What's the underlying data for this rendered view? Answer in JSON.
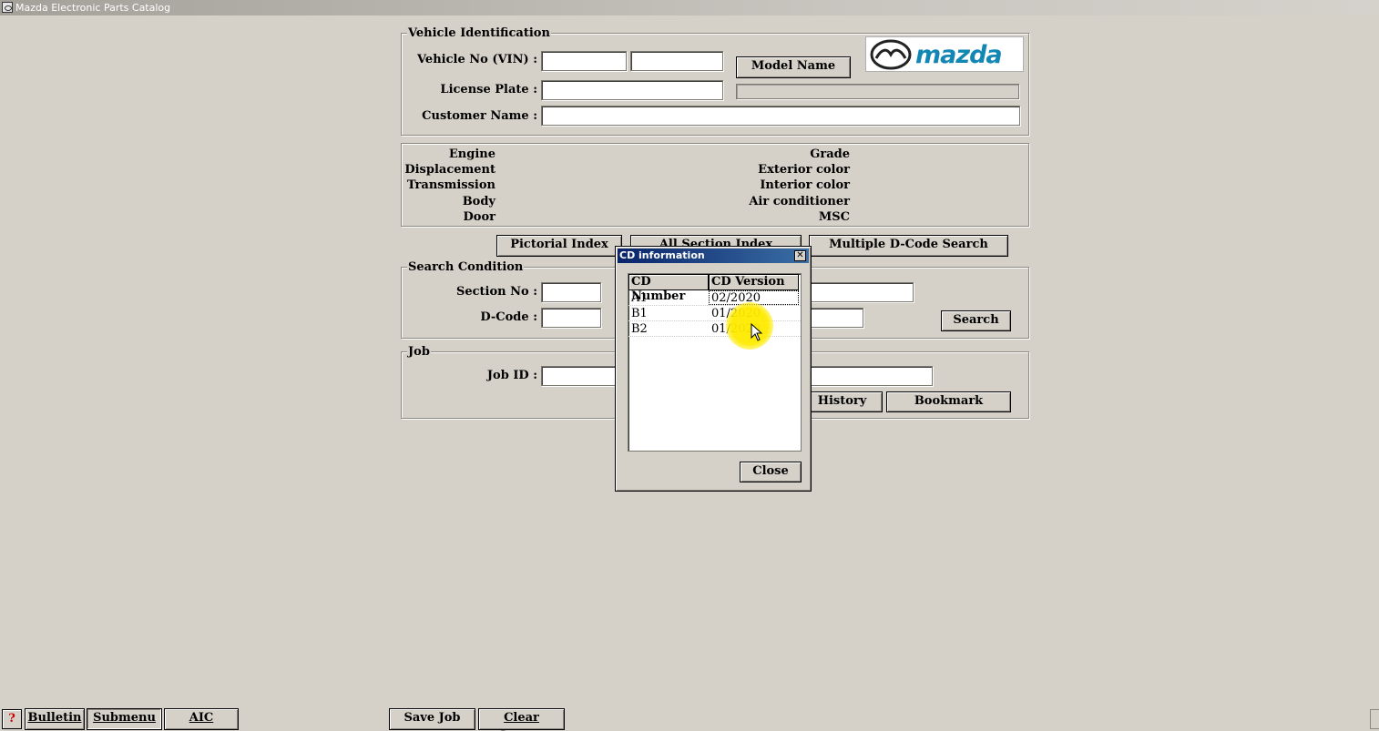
{
  "window": {
    "title": "Mazda Electronic Parts Catalog"
  },
  "vehicle_identification": {
    "title": "Vehicle Identification",
    "vin_label": "Vehicle No (VIN) :",
    "vin_part1": "",
    "vin_part2": "",
    "license_label": "License Plate :",
    "license_value": "",
    "customer_label": "Customer Name :",
    "customer_value": "",
    "model_name_button": "Model Name",
    "model_name_value": "",
    "logo_text": "mazda"
  },
  "specs": {
    "left": [
      "Engine",
      "Displacement",
      "Transmission",
      "Body",
      "Door"
    ],
    "right": [
      "Grade",
      "Exterior color",
      "Interior color",
      "Air conditioner",
      "MSC"
    ]
  },
  "index_buttons": {
    "pictorial": "Pictorial Index",
    "all_section": "All Section Index",
    "multiple": "Multiple D-Code Search"
  },
  "search_condition": {
    "title": "Search Condition",
    "section_label": "Section No :",
    "section_value": "",
    "dcode_label": "D-Code :",
    "dcode_value": "",
    "search_button": "Search"
  },
  "job": {
    "title": "Job",
    "jobid_label": "Job ID :",
    "jobid_value": "",
    "history_button": "History",
    "bookmark_button": "Bookmark"
  },
  "dialog": {
    "title": "CD information",
    "columns": [
      "CD Number",
      "CD Version"
    ],
    "rows": [
      {
        "number": "A1",
        "version": "02/2020"
      },
      {
        "number": "B1",
        "version": "01/2020"
      },
      {
        "number": "B2",
        "version": "01/2020"
      }
    ],
    "close_button": "Close"
  },
  "bottom_bar": {
    "help": "?",
    "bulletin": "Bulletin",
    "submenu": "Submenu",
    "aic": "AIC",
    "save_job": "Save Job",
    "clear_screen": "Clear Screen"
  },
  "colors": {
    "background": "#d5d1c9",
    "dialog_title": "#0a246a",
    "logo": "#1287b4",
    "cursor_highlight": "#ffeb00"
  }
}
